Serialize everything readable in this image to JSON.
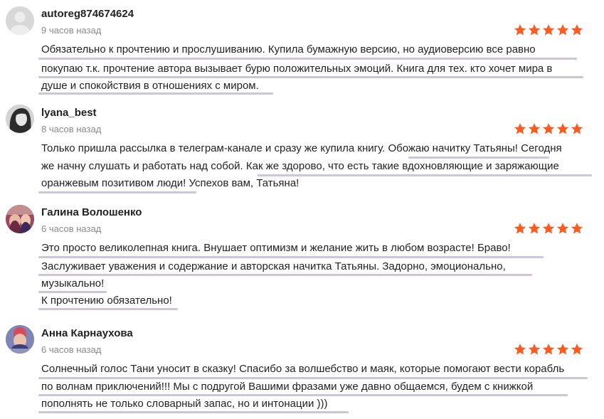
{
  "star_color": "#ff5a1f",
  "highlight_color": "#cdc6da",
  "reviews": [
    {
      "username": "autoreg874674624",
      "time": "9 часов назад",
      "rating": 5,
      "lines": [
        "Обязательно к прочтению и прослушиванию. Купила бумажную версию, но аудиоверсию все равно",
        "покупаю т.к. прочтение автора вызывает бурю положительных эмоций. Книга для тех. кто хочет мира в",
        "душе и спокойствия в отношениях с миром."
      ]
    },
    {
      "username": "lyana_best",
      "time": "8 часов назад",
      "rating": 5,
      "lines": [
        "Только пришла рассылка в телеграм-канале и сразу же купила книгу. Обожаю начитку Татьяны! Сегодня",
        "же начну слушать и работать над собой. Как же здорово, что есть такие вдохновляющие и заряжающие",
        "оранжевым позитивом люди! Успехов вам, Татьяна!"
      ]
    },
    {
      "username": "Галина Волошенко",
      "time": "6 часов назад",
      "rating": 5,
      "lines": [
        "Это просто великолепная книга. Внушает оптимизм и желание жить в любом возрасте! Браво!",
        "Заслуживает уважения и содержание и авторская начитка Татьяны. Задорно, эмоционально,",
        "музыкально!",
        "К прочтению обязательно!"
      ]
    },
    {
      "username": "Анна Карнаухова",
      "time": "6 часов назад",
      "rating": 5,
      "lines": [
        "Солнечный голос Тани уносит в сказку! Спасибо за волшебство и маяк, которые помогают вести корабль",
        "по волнам приключений!!! Мы с подругой Вашими фразами уже давно общаемся, будем с книжкой",
        "пополнять не только словарный запас, но и интонации )))"
      ]
    }
  ]
}
